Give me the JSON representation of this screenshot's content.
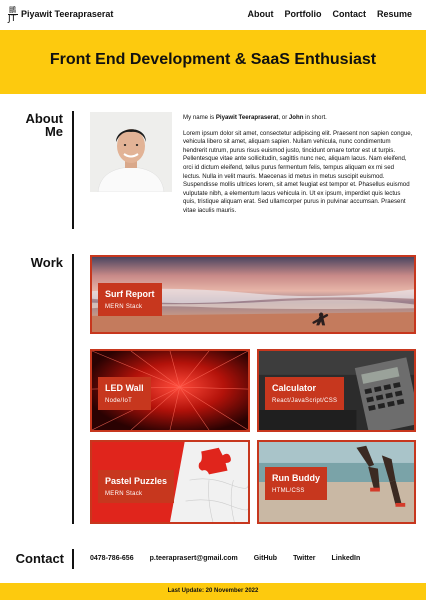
{
  "header": {
    "logo_top": "鵬",
    "logo_bottom": "JT",
    "name": "Piyawit Teerapraserat",
    "nav": [
      "About",
      "Portfolio",
      "Contact",
      "Resume"
    ]
  },
  "hero": {
    "title": "Front End Development & SaaS Enthusiast"
  },
  "about": {
    "title_line1": "About",
    "title_line2": "Me",
    "intro_prefix": "My name is ",
    "intro_name": "Piyawit Teerapraserat",
    "intro_mid": ", or ",
    "intro_nick": "John",
    "intro_suffix": " in short.",
    "body": "Lorem ipsum dolor sit amet, consectetur adipiscing elit. Praesent non sapien congue, vehicula libero sit amet, aliquam sapien. Nullam vehicula, nunc condimentum hendrerit rutrum, purus risus euismod justo, tincidunt ornare tortor est ut turpis. Pellentesque vitae ante sollicitudin, sagittis nunc nec, aliquam lacus. Nam eleifend, orci id dictum eleifend, tellus purus fermentum felis, tempus aliquam ex mi sed lectus. Nulla in velit mauris. Maecenas id metus in metus suscipit euismod. Suspendisse mollis ultrices lorem, sit amet feugiat est tempor et. Phasellus euismod vulputate nibh, a elementum lacus vehicula in. Ut ex ipsum, imperdiet quis lectus quis, tristique aliquam erat. Sed ullamcorper purus in pulvinar accumsan. Praesent vitae iaculis mauris."
  },
  "work": {
    "title": "Work",
    "projects": [
      {
        "title": "Surf Report",
        "stack": "MERN Stack"
      },
      {
        "title": "LED Wall",
        "stack": "Node/IoT"
      },
      {
        "title": "Calculator",
        "stack": "React/JavaScript/CSS"
      },
      {
        "title": "Pastel Puzzles",
        "stack": "MERN Stack"
      },
      {
        "title": "Run Buddy",
        "stack": "HTML/CSS"
      }
    ]
  },
  "contact": {
    "title": "Contact",
    "items": [
      "0478-786-656",
      "p.teeraprasert@gmail.com",
      "GitHub",
      "Twitter",
      "LinkedIn"
    ]
  },
  "footer": {
    "text": "Last Update: 20 November 2022"
  },
  "colors": {
    "accent_yellow": "#fdca0e",
    "tile_red": "#c7371e"
  }
}
